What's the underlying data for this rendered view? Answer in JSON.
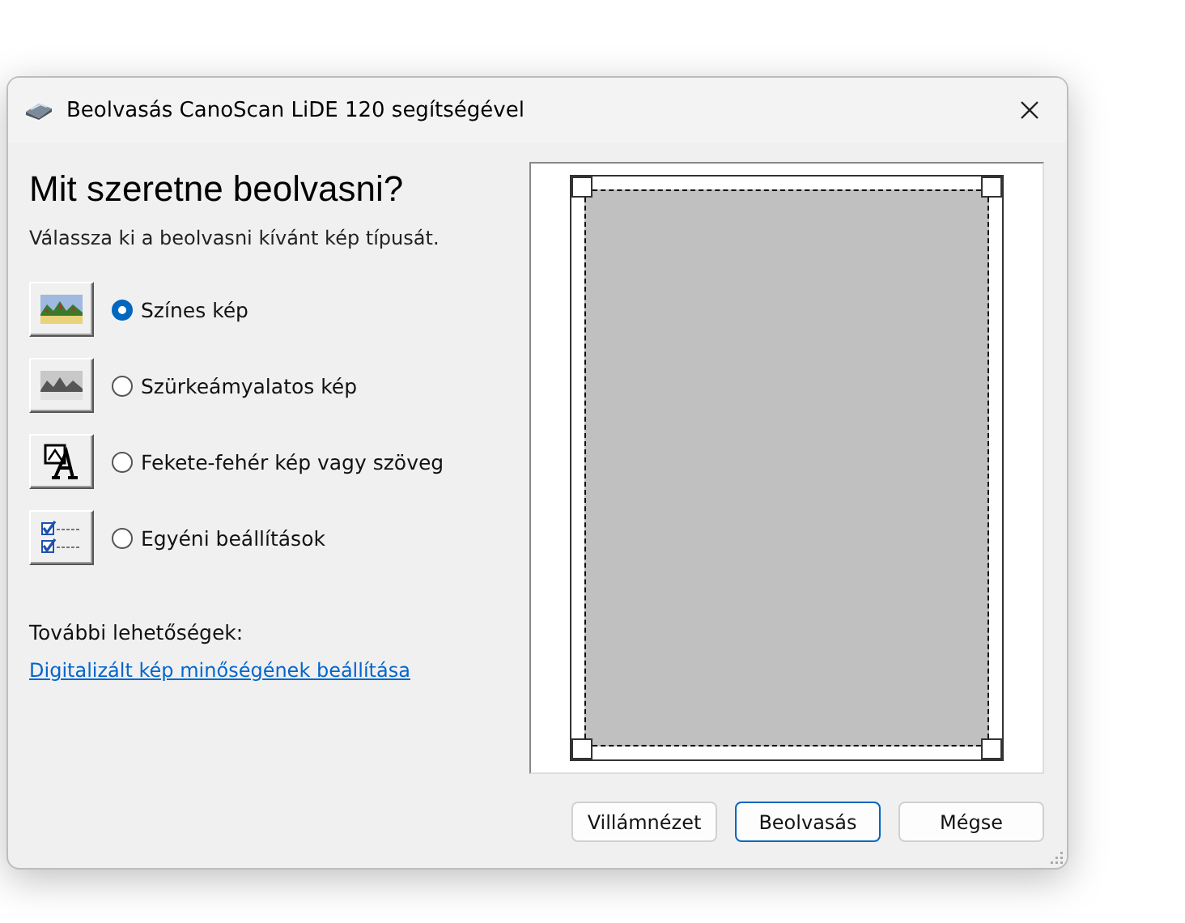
{
  "window": {
    "title": "Beolvasás CanoScan LiDE 120 segítségével"
  },
  "heading": "Mit szeretne beolvasni?",
  "instruction": "Válassza ki a beolvasni kívánt kép típusát.",
  "options": [
    {
      "kind": "color",
      "label": "Színes kép",
      "selected": true
    },
    {
      "kind": "grayscale",
      "label": "Szürkeámyalatos kép",
      "selected": false
    },
    {
      "kind": "text",
      "label": "Fekete-fehér kép vagy szöveg",
      "selected": false
    },
    {
      "kind": "custom",
      "label": "Egyéni beállítások",
      "selected": false
    }
  ],
  "more_label": "További lehetőségek:",
  "more_link": "Digitalizált kép minőségének beállítása",
  "buttons": [
    {
      "label": "Villámnézet",
      "default": false
    },
    {
      "label": "Beolvasás",
      "default": true
    },
    {
      "label": "Mégse",
      "default": false
    }
  ]
}
